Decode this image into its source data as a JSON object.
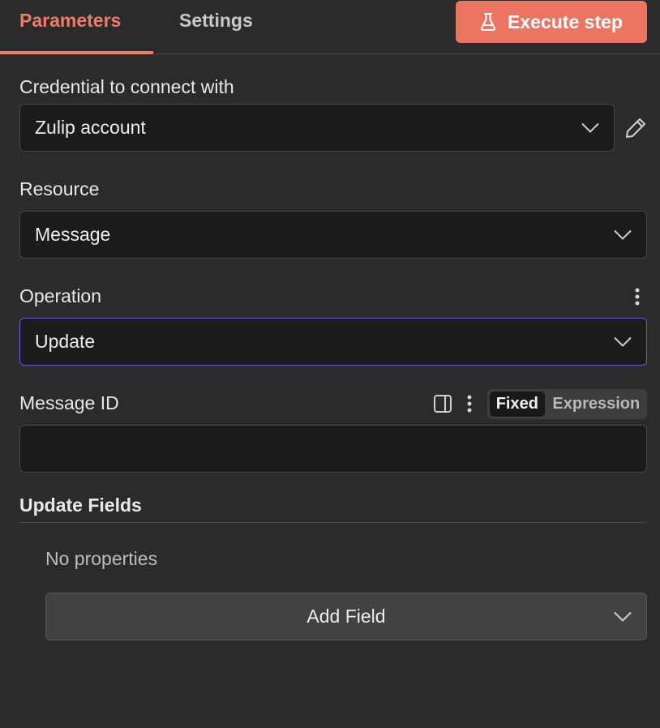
{
  "tabs": {
    "parameters": "Parameters",
    "settings": "Settings"
  },
  "execute_button": {
    "label": "Execute step",
    "icon": "flask-icon"
  },
  "credential": {
    "label": "Credential to connect with",
    "value": "Zulip account"
  },
  "resource": {
    "label": "Resource",
    "value": "Message"
  },
  "operation": {
    "label": "Operation",
    "value": "Update"
  },
  "message_id": {
    "label": "Message ID",
    "value": "",
    "mode_options": [
      "Fixed",
      "Expression"
    ],
    "selected_mode": "Fixed"
  },
  "update_fields": {
    "label": "Update Fields",
    "empty_text": "No properties",
    "add_button": "Add Field"
  },
  "colors": {
    "accent": "#ec7561",
    "focus_border": "#6a5ad4",
    "background": "#2b2b2b"
  }
}
